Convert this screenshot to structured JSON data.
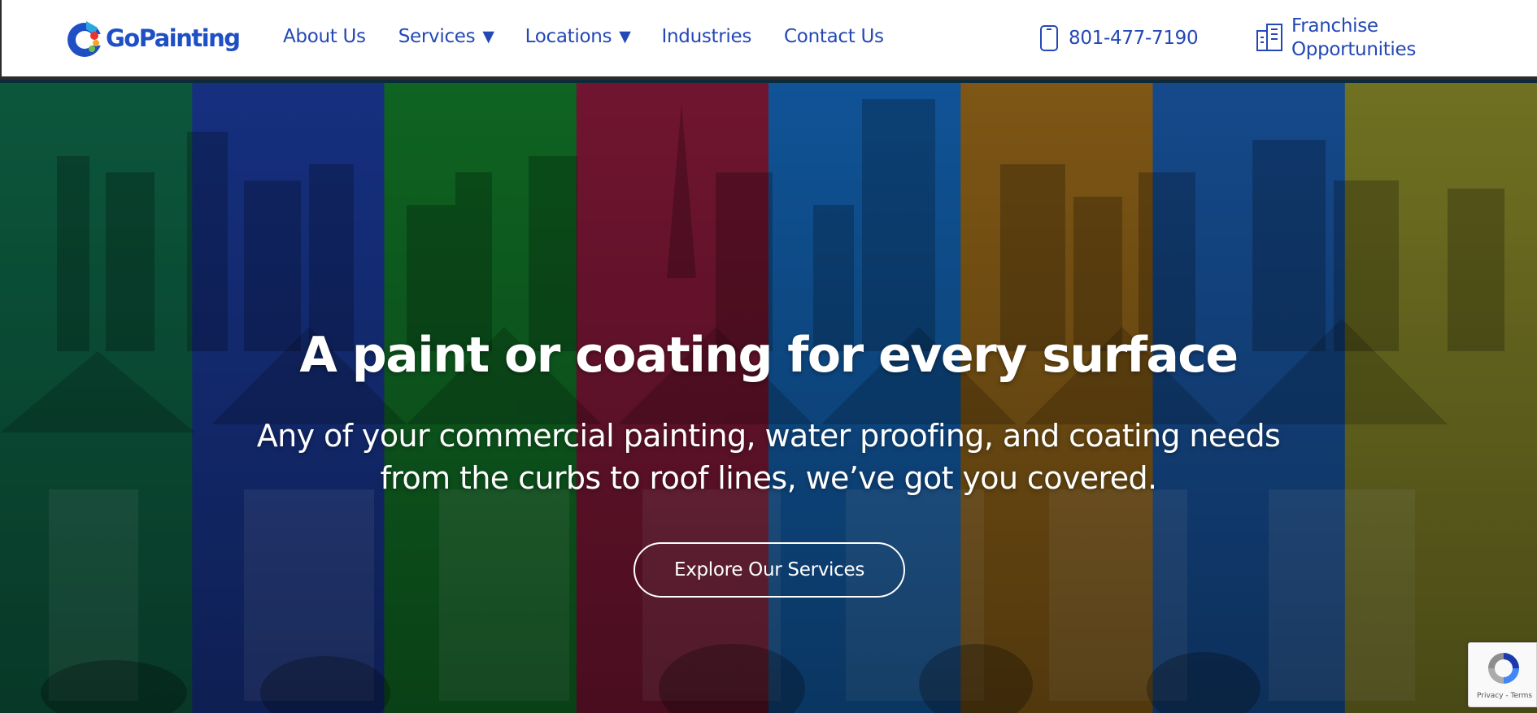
{
  "brand": {
    "name": "GoPainting",
    "color": "#1f4fc4",
    "logo_colors": [
      "#1f4fc4",
      "#29a8e0",
      "#e8342c",
      "#f5a623",
      "#6cc04a"
    ]
  },
  "nav": {
    "items": [
      {
        "label": "About Us",
        "has_dropdown": false
      },
      {
        "label": "Services",
        "has_dropdown": true
      },
      {
        "label": "Locations",
        "has_dropdown": true
      },
      {
        "label": "Industries",
        "has_dropdown": false
      },
      {
        "label": "Contact Us",
        "has_dropdown": false
      }
    ],
    "caret": "▼",
    "color": "#2448b5"
  },
  "phone": {
    "icon": "phone-icon",
    "number": "801-477-7190"
  },
  "franchise": {
    "icon": "building-icon",
    "line1": "Franchise",
    "line2": "Opportunities"
  },
  "hero": {
    "headline": "A paint or coating for every surface",
    "subline_1": "Any of your commercial painting, water proofing, and coating needs",
    "subline_2": "from the curbs to roof lines, we’ve got you covered.",
    "cta_label": "Explore Our Services",
    "stripe_colors": [
      "#0f6a4a",
      "#1b3b9c",
      "#137a2a",
      "#8a1a3c",
      "#1466b8",
      "#9a6a1a",
      "#1a5aaa",
      "#8a8a2a"
    ]
  },
  "recaptcha": {
    "links": "Privacy - Terms",
    "icon": "recaptcha-icon"
  }
}
